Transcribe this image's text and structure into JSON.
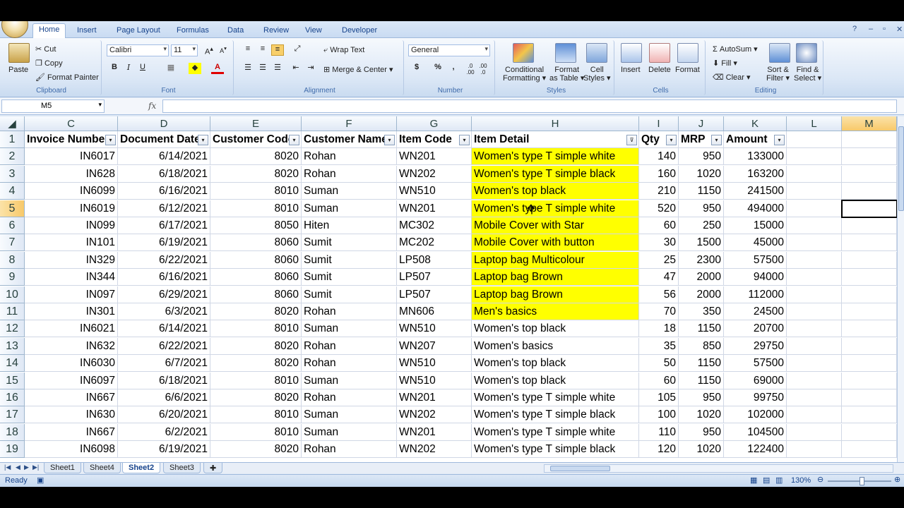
{
  "ribbon_tabs": [
    "Home",
    "Insert",
    "Page Layout",
    "Formulas",
    "Data",
    "Review",
    "View",
    "Developer"
  ],
  "window_controls": [
    "?",
    "–",
    "▫",
    "✕"
  ],
  "clipboard": {
    "paste": "Paste",
    "cut": "Cut",
    "copy": "Copy",
    "format_painter": "Format Painter",
    "label": "Clipboard"
  },
  "font": {
    "name": "Calibri",
    "size": "11",
    "bold": "B",
    "italic": "I",
    "underline": "U",
    "label": "Font"
  },
  "alignment": {
    "wrap_text": "Wrap Text",
    "merge_center": "Merge & Center",
    "label": "Alignment"
  },
  "number": {
    "format": "General",
    "currency": "$",
    "percent": "%",
    "comma": ",",
    "label": "Number"
  },
  "styles": {
    "conditional": "Conditional",
    "formatting": "Formatting",
    "format": "Format",
    "as_table": "as Table",
    "cell": "Cell",
    "cell_styles": "Styles",
    "label": "Styles"
  },
  "cells": {
    "insert": "Insert",
    "delete": "Delete",
    "format": "Format",
    "label": "Cells"
  },
  "editing": {
    "autosum": "AutoSum",
    "fill": "Fill",
    "clear": "Clear",
    "sort": "Sort &",
    "filter": "Filter",
    "find": "Find &",
    "select": "Select",
    "label": "Editing"
  },
  "formula_bar": {
    "name_box": "M5",
    "fx": "fx",
    "formula": ""
  },
  "columns": [
    "C",
    "D",
    "E",
    "F",
    "G",
    "H",
    "I",
    "J",
    "K",
    "L",
    "M"
  ],
  "headers": [
    "Invoice Number",
    "Document Date",
    "Customer Code",
    "Customer Name",
    "Item Code",
    "Item Detail",
    "Qty",
    "MRP",
    "Amount"
  ],
  "rows": [
    [
      "IN6017",
      "6/14/2021",
      "8020",
      "Rohan",
      "WN201",
      "Women's type T simple white",
      "140",
      "950",
      "133000"
    ],
    [
      "IN628",
      "6/18/2021",
      "8020",
      "Rohan",
      "WN202",
      "Women's type T simple black",
      "160",
      "1020",
      "163200"
    ],
    [
      "IN6099",
      "6/16/2021",
      "8010",
      "Suman",
      "WN510",
      "Women's top black",
      "210",
      "1150",
      "241500"
    ],
    [
      "IN6019",
      "6/12/2021",
      "8010",
      "Suman",
      "WN201",
      "Women's type T simple white",
      "520",
      "950",
      "494000"
    ],
    [
      "IN099",
      "6/17/2021",
      "8050",
      "Hiten",
      "MC302",
      "Mobile Cover with Star",
      "60",
      "250",
      "15000"
    ],
    [
      "IN101",
      "6/19/2021",
      "8060",
      "Sumit",
      "MC202",
      "Mobile Cover with button",
      "30",
      "1500",
      "45000"
    ],
    [
      "IN329",
      "6/22/2021",
      "8060",
      "Sumit",
      "LP508",
      "Laptop bag Multicolour",
      "25",
      "2300",
      "57500"
    ],
    [
      "IN344",
      "6/16/2021",
      "8060",
      "Sumit",
      "LP507",
      "Laptop bag Brown",
      "47",
      "2000",
      "94000"
    ],
    [
      "IN097",
      "6/29/2021",
      "8060",
      "Sumit",
      "LP507",
      "Laptop bag Brown",
      "56",
      "2000",
      "112000"
    ],
    [
      "IN301",
      "6/3/2021",
      "8020",
      "Rohan",
      "MN606",
      "Men's basics",
      "70",
      "350",
      "24500"
    ],
    [
      "IN6021",
      "6/14/2021",
      "8010",
      "Suman",
      "WN510",
      "Women's top black",
      "18",
      "1150",
      "20700"
    ],
    [
      "IN632",
      "6/22/2021",
      "8020",
      "Rohan",
      "WN207",
      "Women's basics",
      "35",
      "850",
      "29750"
    ],
    [
      "IN6030",
      "6/7/2021",
      "8020",
      "Rohan",
      "WN510",
      "Women's top black",
      "50",
      "1150",
      "57500"
    ],
    [
      "IN6097",
      "6/18/2021",
      "8010",
      "Suman",
      "WN510",
      "Women's top black",
      "60",
      "1150",
      "69000"
    ],
    [
      "IN667",
      "6/6/2021",
      "8020",
      "Rohan",
      "WN201",
      "Women's type T simple white",
      "105",
      "950",
      "99750"
    ],
    [
      "IN630",
      "6/20/2021",
      "8010",
      "Suman",
      "WN202",
      "Women's type T simple black",
      "100",
      "1020",
      "102000"
    ],
    [
      "IN667",
      "6/2/2021",
      "8010",
      "Suman",
      "WN201",
      "Women's type T simple white",
      "110",
      "950",
      "104500"
    ],
    [
      "IN6098",
      "6/19/2021",
      "8020",
      "Rohan",
      "WN202",
      "Women's type T simple black",
      "120",
      "1020",
      "122400"
    ]
  ],
  "highlight_rows": 10,
  "highlight_color": "#ffff00",
  "active_cell": "M5",
  "sheet_tabs": [
    "Sheet1",
    "Sheet4",
    "Sheet2",
    "Sheet3"
  ],
  "active_sheet": "Sheet2",
  "status": {
    "ready": "Ready",
    "zoom": "130%"
  }
}
